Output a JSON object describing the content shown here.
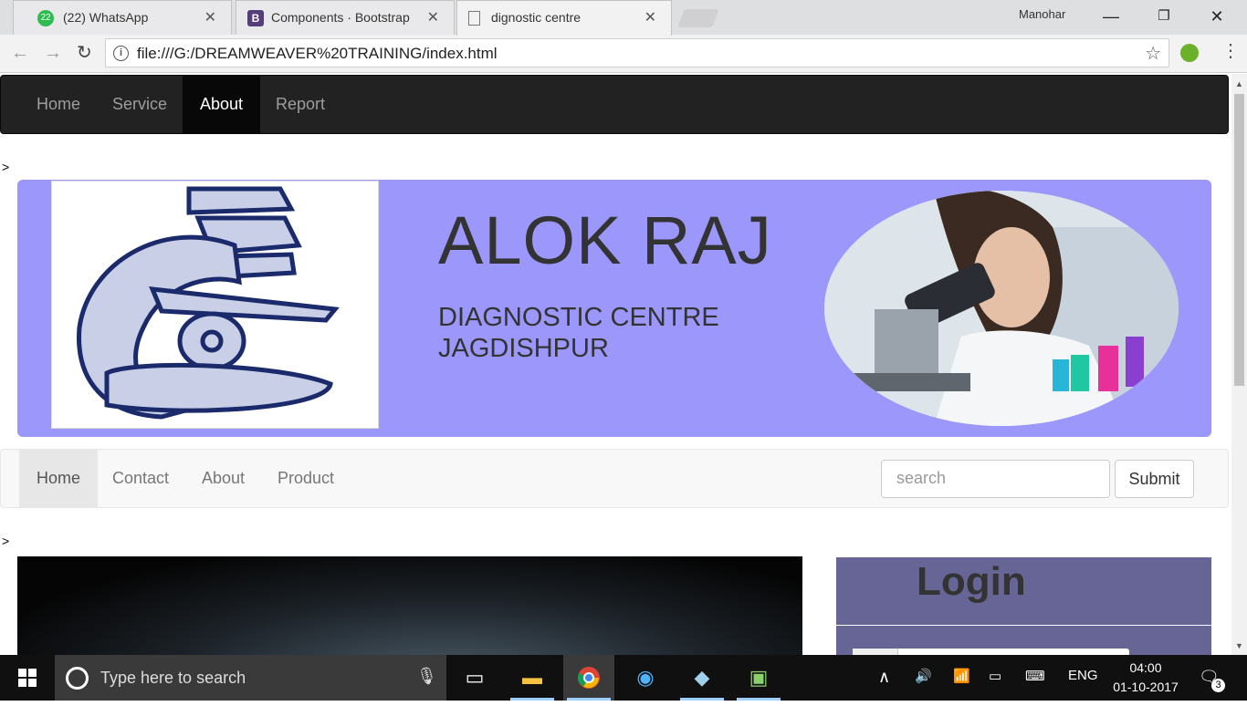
{
  "browser": {
    "tabs": [
      {
        "title": "(22) WhatsApp",
        "badge": "22",
        "icon": "whatsapp-icon"
      },
      {
        "title": "Components · Bootstrap",
        "badge": "B",
        "icon": "bootstrap-icon"
      },
      {
        "title": "dignostic centre",
        "icon": "page-icon"
      }
    ],
    "profile": "Manohar",
    "url": "file:///G:/DREAMWEAVER%20TRAINING/index.html"
  },
  "page": {
    "stray_marker": ">",
    "top_nav": [
      "Home",
      "Service",
      "About",
      "Report"
    ],
    "top_nav_active": "About",
    "banner": {
      "title": "ALOK RAJ",
      "subtitle_line1": "DIAGNOSTIC CENTRE",
      "subtitle_line2": "JAGDISHPUR",
      "background_color": "#9b97fb"
    },
    "sub_nav": [
      "Home",
      "Contact",
      "About",
      "Product"
    ],
    "sub_nav_active": "Home",
    "search_placeholder": "search",
    "submit_label": "Submit",
    "login_heading": "Login",
    "login_color": "#676595"
  },
  "taskbar": {
    "search_placeholder": "Type here to search",
    "language": "ENG",
    "time": "04:00",
    "date": "01-10-2017",
    "notification_count": "3"
  }
}
